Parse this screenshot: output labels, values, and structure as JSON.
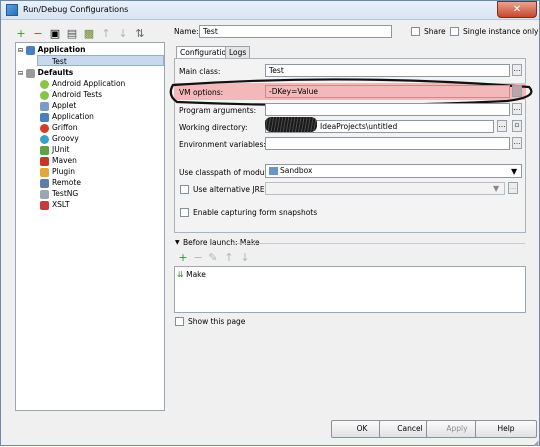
{
  "window": {
    "title": "Run/Debug Configurations",
    "close_glyph": "✕"
  },
  "toolbar": {
    "icons": [
      "add-icon",
      "remove-icon",
      "copy-icon",
      "save-icon",
      "folder-icon",
      "up-icon",
      "down-icon",
      "sort-icon"
    ]
  },
  "tree": {
    "application": "Application",
    "application_child": "Test",
    "defaults": "Defaults",
    "items": [
      "Android Application",
      "Android Tests",
      "Applet",
      "Application",
      "Griffon",
      "Groovy",
      "JUnit",
      "Maven",
      "Plugin",
      "Remote",
      "TestNG",
      "XSLT"
    ]
  },
  "header": {
    "name_label": "Name:",
    "name_value": "Test",
    "share_label": "Share",
    "single_instance_label": "Single instance only"
  },
  "tabs": {
    "configuration": "Configuration",
    "logs": "Logs"
  },
  "config": {
    "main_class_label": "Main class:",
    "main_class_value": "Test",
    "vm_options_label": "VM options:",
    "vm_options_value": "-DKey=Value",
    "program_args_label": "Program arguments:",
    "program_args_value": "",
    "working_dir_label": "Working directory:",
    "working_dir_value": "IdeaProjects\\untitled",
    "env_vars_label": "Environment variables:",
    "env_vars_value": "",
    "classpath_label": "Use classpath of module:",
    "classpath_value": "Sandbox",
    "alt_jre_label": "Use alternative JRE:",
    "snapshots_label": "Enable capturing form snapshots"
  },
  "before_launch": {
    "header": "Before launch: Make",
    "item": "Make",
    "show_page_label": "Show this page"
  },
  "buttons": {
    "ok": "OK",
    "cancel": "Cancel",
    "apply": "Apply",
    "help": "Help"
  },
  "colors": {
    "highlight": "#f3b8b9",
    "selection": "#c7d8ef"
  }
}
